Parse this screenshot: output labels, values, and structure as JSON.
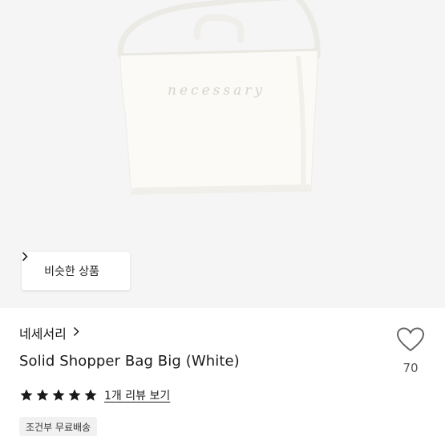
{
  "image": {
    "product_image_alt": "Solid Shopper Bag Big (White)",
    "bag_embroidery": "necessary"
  },
  "similar_products_button": {
    "label": "비슷한 상품",
    "icon": "chevron-right-icon"
  },
  "product": {
    "brand": "네세서리",
    "brand_icon": "chevron-right-icon",
    "title": "Solid Shopper Bag Big (White)",
    "rating_stars": 5,
    "reviews_label": "1개 리뷰 보기",
    "shipping_badge": "조건부 무료배송"
  },
  "favorite": {
    "icon": "heart-outline-icon",
    "count": "70"
  },
  "colors": {
    "star": "#1a1a1a",
    "text": "#1a1a1a",
    "image_bg": "#f5f5f5"
  }
}
